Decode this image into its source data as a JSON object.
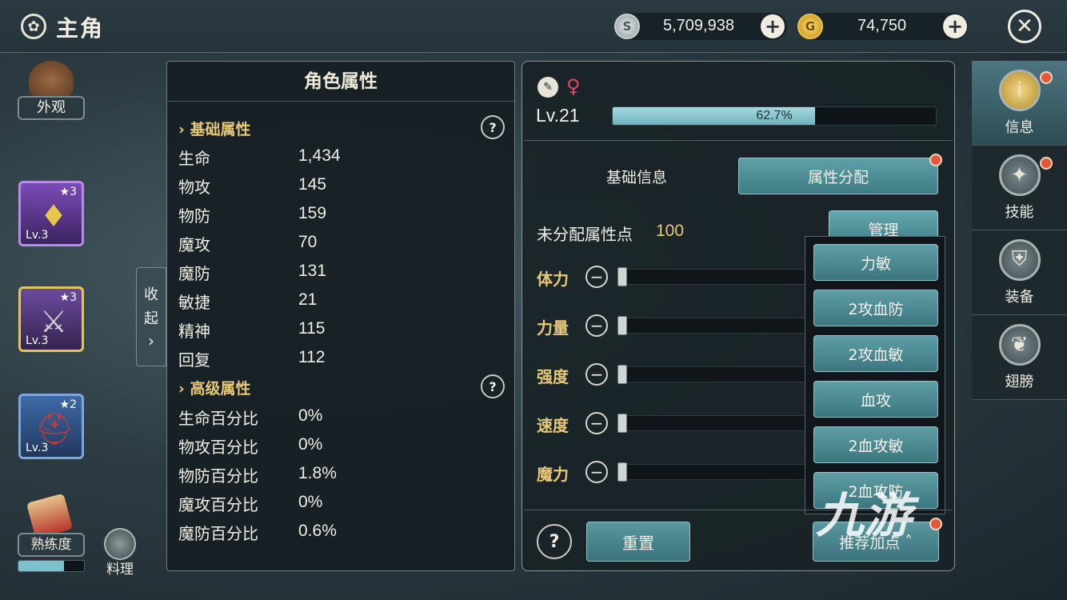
{
  "header": {
    "title": "主角",
    "silver": "5,709,938",
    "gold": "74,750"
  },
  "left": {
    "appearance_label": "外观",
    "equip": [
      {
        "stars": "3",
        "level": "Lv.3"
      },
      {
        "stars": "3",
        "level": "Lv.3"
      },
      {
        "stars": "2",
        "level": "Lv.3"
      }
    ],
    "proficiency_label": "熟练度",
    "proficiency_progress": 0.7,
    "cooking_label": "料理",
    "collapse_label_1": "收",
    "collapse_label_2": "起"
  },
  "attr_panel": {
    "title": "角色属性",
    "basic_title": "基础属性",
    "basic": [
      {
        "name": "生命",
        "value": "1,434"
      },
      {
        "name": "物攻",
        "value": "145"
      },
      {
        "name": "物防",
        "value": "159"
      },
      {
        "name": "魔攻",
        "value": "70"
      },
      {
        "name": "魔防",
        "value": "131"
      },
      {
        "name": "敏捷",
        "value": "21"
      },
      {
        "name": "精神",
        "value": "115"
      },
      {
        "name": "回复",
        "value": "112"
      }
    ],
    "advanced_title": "高级属性",
    "advanced": [
      {
        "name": "生命百分比",
        "value": "0%"
      },
      {
        "name": "物攻百分比",
        "value": "0%"
      },
      {
        "name": "物防百分比",
        "value": "1.8%"
      },
      {
        "name": "魔攻百分比",
        "value": "0%"
      },
      {
        "name": "魔防百分比",
        "value": "0.6%"
      }
    ]
  },
  "info": {
    "level": "Lv.21",
    "exp_text": "62.7%",
    "exp_progress": 0.627,
    "tab_basic": "基础信息",
    "tab_alloc": "属性分配",
    "unalloc_label": "未分配属性点",
    "unalloc_value": "100",
    "manage_label": "管理",
    "stats": [
      "体力",
      "力量",
      "强度",
      "速度",
      "魔力"
    ],
    "presets": [
      "力敏",
      "2攻血防",
      "2攻血敏",
      "血攻",
      "2血攻敏",
      "2血攻防"
    ],
    "reset_label": "重置",
    "recommend_label": "推荐加点"
  },
  "nav": {
    "items": [
      "信息",
      "技能",
      "装备",
      "翅膀"
    ]
  },
  "watermark": "九游",
  "colors": {
    "accent": "#e6c87a",
    "button": "#4a8a93",
    "badge": "#e4573a"
  }
}
